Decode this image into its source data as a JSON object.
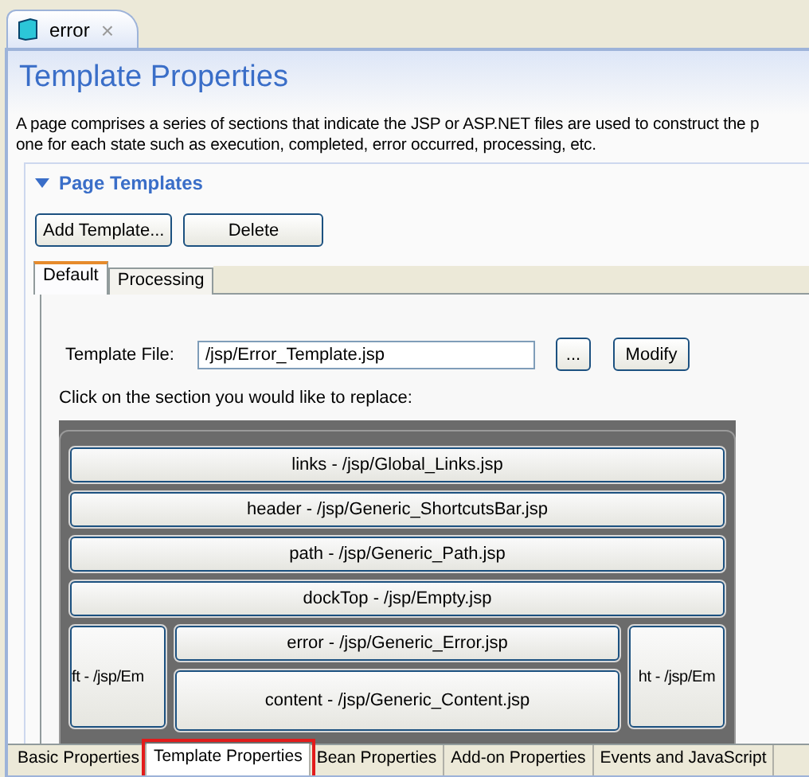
{
  "editor_tab": {
    "title": "error",
    "close": "×"
  },
  "title": "Template Properties",
  "description": [
    "A page comprises a series of sections that indicate the JSP or ASP.NET files are used to construct the p",
    "one for each state such as execution, completed, error occurred, processing, etc."
  ],
  "section": {
    "title": "Page Templates",
    "expanded": true
  },
  "buttons": [
    "Add Template...",
    "Delete"
  ],
  "tabs": [
    {
      "label": "Default",
      "selected": true
    },
    {
      "label": "Processing",
      "selected": false
    }
  ],
  "template_file": {
    "label": "Template File:",
    "value": "/jsp/Error_Template.jsp",
    "browse": "...",
    "modify": "Modify"
  },
  "instruction": "Click on the section you would like to replace:",
  "layout": {
    "rows": [
      {
        "label": "links - /jsp/Global_Links.jsp"
      },
      {
        "label": "header - /jsp/Generic_ShortcutsBar.jsp"
      },
      {
        "label": "path - /jsp/Generic_Path.jsp"
      },
      {
        "label": "dockTop - /jsp/Empty.jsp"
      }
    ],
    "left": "ft - /jsp/Em",
    "right": "ht - /jsp/Em",
    "center": [
      {
        "label": "error - /jsp/Generic_Error.jsp"
      },
      {
        "label": "content - /jsp/Generic_Content.jsp"
      }
    ]
  },
  "bottom_tabs": [
    {
      "label": "Basic Properties",
      "selected": false,
      "highlighted": false
    },
    {
      "label": "Template Properties",
      "selected": true,
      "highlighted": true
    },
    {
      "label": "Bean Properties",
      "selected": false,
      "highlighted": false
    },
    {
      "label": "Add-on Properties",
      "selected": false,
      "highlighted": false
    },
    {
      "label": "Events and JavaScript",
      "selected": false,
      "highlighted": false
    }
  ]
}
